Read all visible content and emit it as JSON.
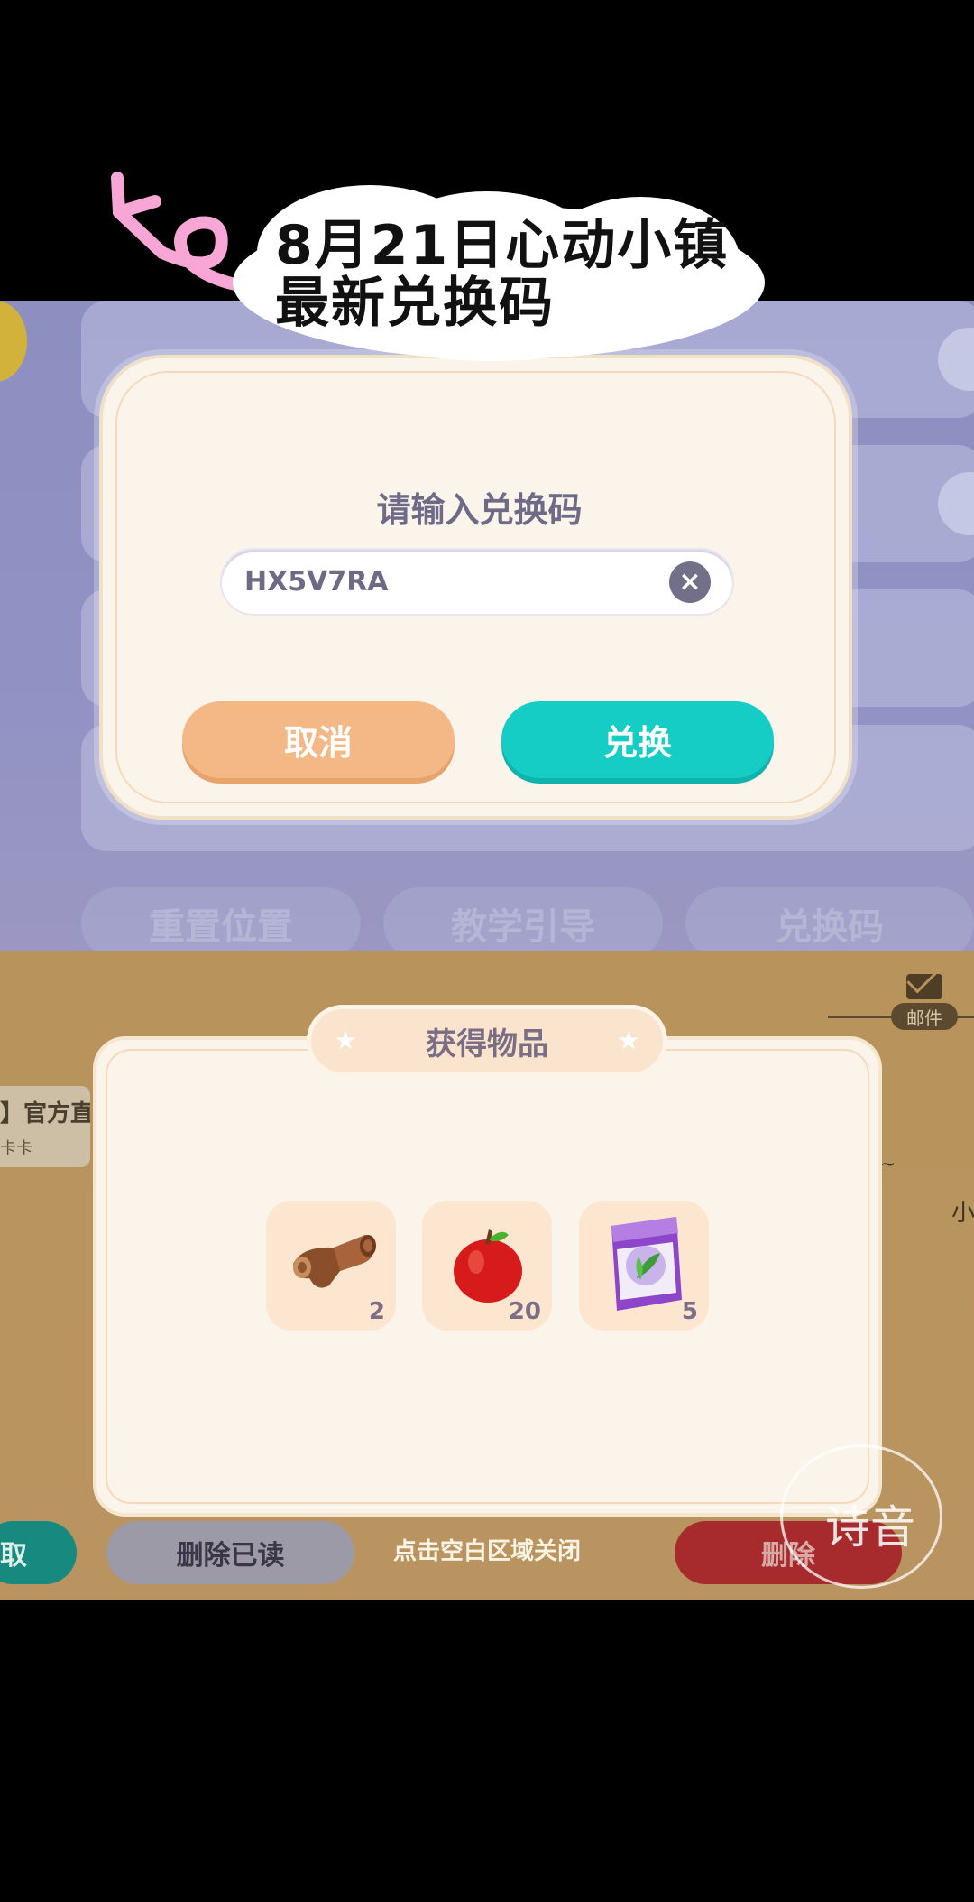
{
  "overlay": {
    "title_line1": "8月21日心动小镇",
    "title_line2": "最新兑换码"
  },
  "background": {
    "tabs": [
      "重置位置",
      "教学引导",
      "兑换码"
    ],
    "mail_label": "邮件",
    "mail_item_title": "】官方直",
    "mail_item_sub": "卡卡",
    "right_fragment": "小",
    "tilde": "~",
    "buttons": {
      "left_green": "取",
      "delete_read": "删除已读",
      "delete": "删除"
    },
    "close_hint": "点击空白区域关闭"
  },
  "redeem_dialog": {
    "title": "请输入兑换码",
    "code_value": "HX5V7RA",
    "cancel_label": "取消",
    "redeem_label": "兑换"
  },
  "items_dialog": {
    "title": "获得物品",
    "items": [
      {
        "name": "wood-log",
        "count": "2"
      },
      {
        "name": "red-apple",
        "count": "20"
      },
      {
        "name": "seed-pack",
        "count": "5"
      }
    ]
  },
  "watermark": "诗音",
  "colors": {
    "cancel": "#f3b885",
    "redeem": "#15cdc4",
    "dialog_bg": "#fbf4ea"
  }
}
